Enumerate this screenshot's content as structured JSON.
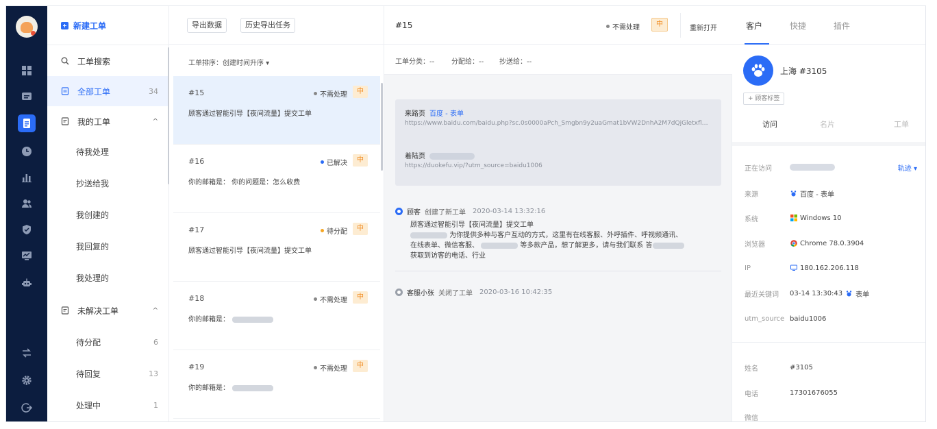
{
  "colors": {
    "accent": "#2b6cf6",
    "rail": "#0c1d3f",
    "priority": "#f08b21"
  },
  "nav": {
    "new_ticket": "新建工单",
    "search": "工单搜索",
    "all": {
      "label": "全部工单",
      "count": "34"
    },
    "mine": {
      "label": "我的工单",
      "caret": "^"
    },
    "mine_items": [
      "待我处理",
      "抄送给我",
      "我创建的",
      "我回复的",
      "我处理的"
    ],
    "unresolved": {
      "label": "未解决工单",
      "caret": "^"
    },
    "unresolved_items": [
      {
        "label": "待分配",
        "count": "6"
      },
      {
        "label": "待回复",
        "count": "13"
      },
      {
        "label": "处理中",
        "count": "1"
      }
    ]
  },
  "list": {
    "export": "导出数据",
    "history": "历史导出任务",
    "sort": "工单排序：创建时间升序 ▾",
    "tickets": [
      {
        "id": "#15",
        "status": "不需处理",
        "status_color": "#888888",
        "priority": "中",
        "desc": "顾客通过智能引导【夜间流量】提交工单"
      },
      {
        "id": "#16",
        "status": "已解决",
        "status_color": "#2b6cf6",
        "priority": "中",
        "desc": "你的邮箱是：  你的问题是：怎么收费"
      },
      {
        "id": "#17",
        "status": "待分配",
        "status_color": "#f5a623",
        "priority": "中",
        "desc": "顾客通过智能引导【夜间流量】提交工单"
      },
      {
        "id": "#18",
        "status": "不需处理",
        "status_color": "#888888",
        "priority": "中",
        "desc": "你的邮箱是："
      },
      {
        "id": "#19",
        "status": "不需处理",
        "status_color": "#888888",
        "priority": "中",
        "desc": "你的邮箱是："
      }
    ]
  },
  "detail": {
    "id": "#15",
    "status": "不需处理",
    "priority": "中",
    "reopen": "重新打开",
    "category": "工单分类：--",
    "assignee": "分配给：--",
    "cc": "抄送给：--",
    "source_label": "来路页",
    "source_link": "百度 - 表单",
    "source_url": "https://www.baidu.com/baidu.php?sc.0s0000aPch_Smgbn9y2uaGmat1bVW2DnhA2M7dQjGletxfl67ru_ZkwVjBwzeBMUWa8geQVzqfG_TTTq9Vz90Z33YAgS4WXIfTZ0NrhI3ETzAa...",
    "visit_label": "着陆页",
    "visit_url": "https://duokefu.vip/?utm_source=baidu1006",
    "event1": {
      "who": "顾客",
      "action": "创建了新工单",
      "time": "2020-03-14 13:32:16"
    },
    "message_line1": "顾客通过智能引导【夜间流量】提交工单",
    "message_line2": "为你提供多种与客户互动的方式，这里有在线客服、外呼插件、呼视频通讯、",
    "message_line3": "在线表单、微信客服、",
    "message_line3b": "等多款产品，想了解更多，请与我们联系 答",
    "message_line4": "获取到访客的电话、行业",
    "event2": {
      "who": "客服小张",
      "action": "关闭了工单",
      "time": "2020-03-16 10:42:35"
    }
  },
  "customer": {
    "tabs": [
      "客户",
      "快捷",
      "插件"
    ],
    "name": "上海 #3105",
    "add_tag": "+ 顾客标签",
    "subtabs": [
      "访问",
      "名片",
      "工单"
    ],
    "rows": {
      "visiting_label": "正在访问",
      "track": "轨迹 ▾",
      "source_label": "来源",
      "source_value": "百度 - 表单",
      "os_label": "系统",
      "os_value": "Windows 10",
      "browser_label": "浏览器",
      "browser_value": "Chrome 78.0.3904",
      "ip_label": "IP",
      "ip_value": "180.162.206.118",
      "keyword_label": "最近关键词",
      "keyword_time": "03-14 13:30:43",
      "keyword_value": "表单",
      "utm_label": "utm_source",
      "utm_value": "baidu1006",
      "name_label": "姓名",
      "name_value": "#3105",
      "phone_label": "电话",
      "phone_value": "17301676055",
      "wechat_label": "微信"
    }
  }
}
